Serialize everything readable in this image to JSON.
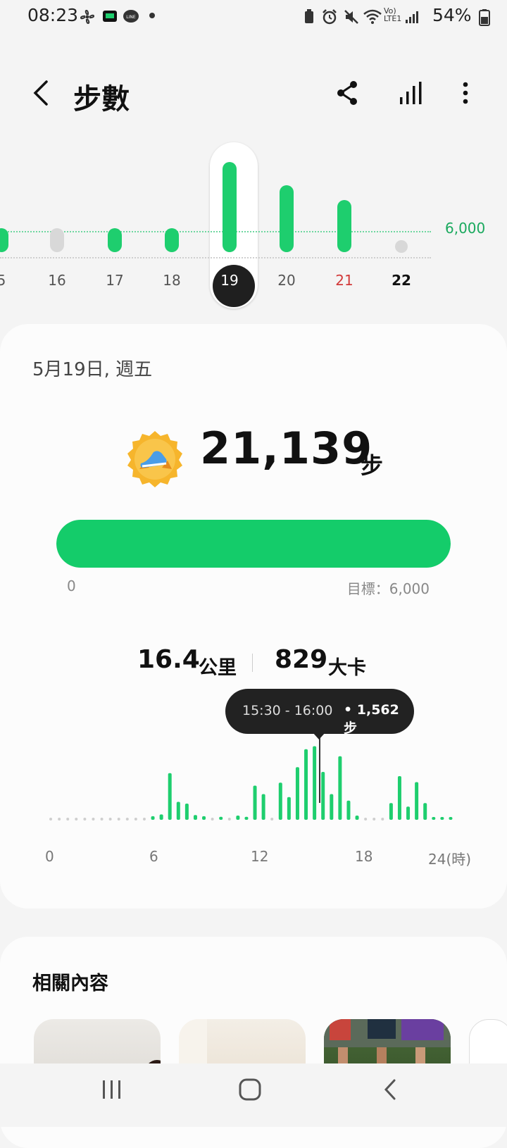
{
  "status": {
    "time": "08:23",
    "battery_pct": "54%",
    "network": "Vo) LTE1"
  },
  "header": {
    "title": "步數"
  },
  "day_strip": {
    "goal_label": "6,000",
    "days": [
      {
        "label": "5",
        "fraction": 0.18,
        "style": "normal"
      },
      {
        "label": "16",
        "fraction": 0.12,
        "style": "empty"
      },
      {
        "label": "17",
        "fraction": 0.16,
        "style": "normal"
      },
      {
        "label": "18",
        "fraction": 0.19,
        "style": "normal"
      },
      {
        "label": "19",
        "fraction": 1.0,
        "style": "selected"
      },
      {
        "label": "20",
        "fraction": 0.74,
        "style": "normal"
      },
      {
        "label": "21",
        "fraction": 0.58,
        "style": "weekend"
      },
      {
        "label": "22",
        "fraction": 0,
        "style": "today"
      }
    ]
  },
  "summary": {
    "date": "5月19日, 週五",
    "steps": "21,139",
    "steps_unit": "步",
    "progress_fraction": 1.0,
    "progress_min": "0",
    "progress_goal": "目標：6,000",
    "distance": "16.4",
    "distance_unit": "公里",
    "calories": "829",
    "calories_unit": "大卡"
  },
  "tooltip": {
    "time": "15:30 - 16:00",
    "steps": "•  1,562 步"
  },
  "chart_data": {
    "type": "bar",
    "title": "",
    "xlabel": "",
    "ylabel": "",
    "x_ticks": [
      "0",
      "6",
      "12",
      "18",
      "24(時)"
    ],
    "bin_hours": 0.5,
    "values": [
      0,
      0,
      0,
      0,
      0,
      0,
      0,
      0,
      0,
      0,
      0,
      0,
      60,
      90,
      780,
      300,
      270,
      80,
      60,
      0,
      50,
      0,
      70,
      50,
      570,
      430,
      0,
      620,
      380,
      880,
      1180,
      1230,
      800,
      430,
      1062,
      320,
      70,
      0,
      0,
      0,
      280,
      730,
      220,
      630,
      280,
      30,
      30,
      30
    ],
    "ylim": [
      0,
      1600
    ]
  },
  "related": {
    "title": "相關內容"
  }
}
